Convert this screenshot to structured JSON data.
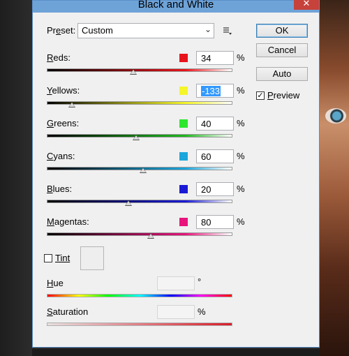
{
  "window": {
    "title": "Black and White",
    "close_glyph": "✕"
  },
  "preset": {
    "label": "Preset:",
    "value": "Custom",
    "menu_icon": "preset-options-icon"
  },
  "channels": [
    {
      "label": "Reds:",
      "value": "34",
      "unit": "%",
      "color": "#e8141b",
      "percent_range": [
        -200,
        300
      ]
    },
    {
      "label": "Yellows:",
      "value": "-133",
      "unit": "%",
      "color": "#f5f52a"
    },
    {
      "label": "Greens:",
      "value": "40",
      "unit": "%",
      "color": "#2ee62e"
    },
    {
      "label": "Cyans:",
      "value": "60",
      "unit": "%",
      "color": "#1aa6dc"
    },
    {
      "label": "Blues:",
      "value": "20",
      "unit": "%",
      "color": "#1a1ad6"
    },
    {
      "label": "Magentas:",
      "value": "80",
      "unit": "%",
      "color": "#e8147c"
    }
  ],
  "buttons": {
    "ok": "OK",
    "cancel": "Cancel",
    "auto": "Auto"
  },
  "preview": {
    "label": "Preview",
    "checked": true
  },
  "tint": {
    "label": "Tint",
    "checked": false
  },
  "hue": {
    "label": "Hue",
    "value": "",
    "unit": "°"
  },
  "saturation": {
    "label": "Saturation",
    "value": "",
    "unit": "%"
  }
}
